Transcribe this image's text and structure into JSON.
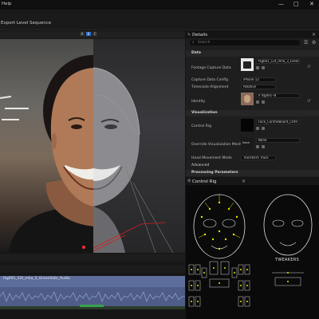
{
  "window": {
    "menu_help": "Help",
    "controls": {
      "minimize": "—",
      "maximize": "□",
      "close": "✕"
    }
  },
  "toolbar": {
    "export_label": "Export Level Sequence"
  },
  "viewport": {
    "mode_buttons": [
      "A",
      "B",
      "C"
    ]
  },
  "details": {
    "tab_title": "Details",
    "search_placeholder": "Search",
    "sections": {
      "data": "Data",
      "visualization": "Visualization",
      "advanced": "Advanced",
      "processing": "Processing Parameters"
    },
    "rows": {
      "footage_label": "Footage Capture Data",
      "footage_value": "fsg001_12t_mha_3_Green",
      "capture_config_label": "Capture Data Config",
      "capture_config_value": "iPhone 12",
      "timecode_label": "Timecode Alignment",
      "timecode_value": "Relative",
      "identity_label": "Identity",
      "identity_value": "Il fsg001-id",
      "control_rig_label": "Control Rig",
      "control_rig_value": "Face_ControlBoard_CtrlR",
      "override_mesh_label": "Override Visualization Mesh",
      "override_mesh_value": "None",
      "head_movement_label": "Head Movement Mode",
      "head_movement_value": "Transform Track"
    }
  },
  "control_rig": {
    "tab_title": "Control Rig",
    "tweakers_label": "TWEAKERS"
  },
  "timeline": {
    "track_label": "fsg001_12t_mha_3_GreenSebr_Audio"
  },
  "colors": {
    "panel_bg": "#1e1e1e",
    "section_bg": "#262626",
    "accent_blue": "#2a6fd6",
    "rig_yellow": "#e8e000",
    "track_blue": "#5e6e9c"
  }
}
